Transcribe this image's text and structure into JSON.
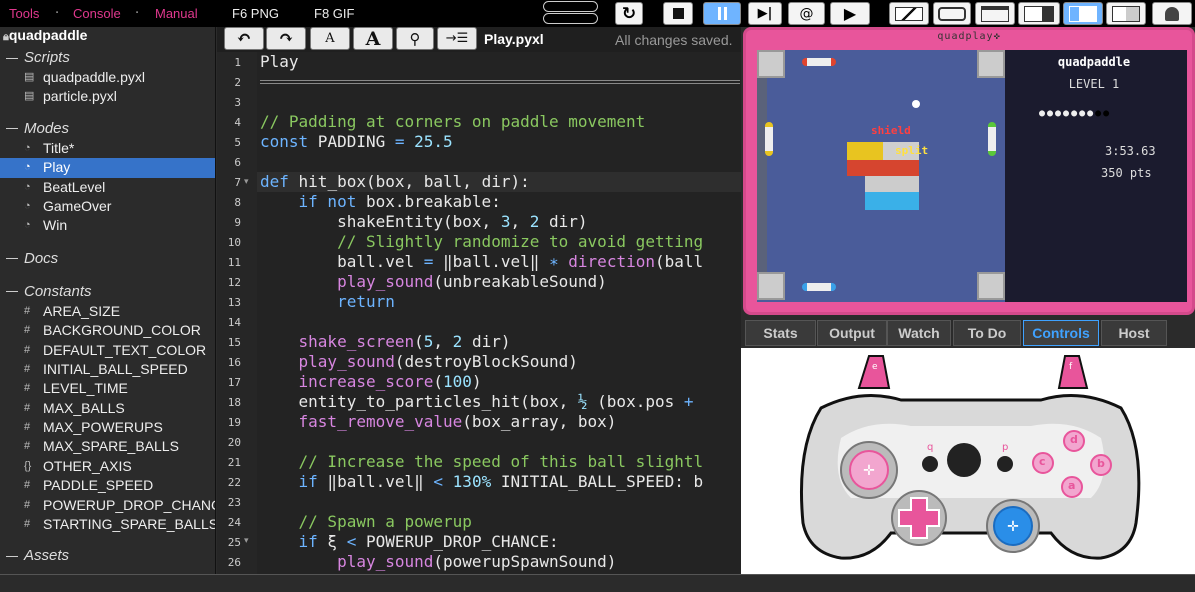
{
  "menu": {
    "tools": "Tools",
    "console": "Console",
    "manual": "Manual",
    "f6": "F6 PNG",
    "f8": "F8 GIF"
  },
  "project": {
    "name": "quadpaddle",
    "sections": {
      "scripts": "Scripts",
      "modes": "Modes",
      "docs": "Docs",
      "constants": "Constants",
      "assets": "Assets"
    },
    "scripts": [
      "quadpaddle.pyxl",
      "particle.pyxl"
    ],
    "modes": [
      "Title*",
      "Play",
      "BeatLevel",
      "GameOver",
      "Win"
    ],
    "constants": [
      "AREA_SIZE",
      "BACKGROUND_COLOR",
      "DEFAULT_TEXT_COLOR",
      "INITIAL_BALL_SPEED",
      "LEVEL_TIME",
      "MAX_BALLS",
      "MAX_POWERUPS",
      "MAX_SPARE_BALLS",
      "OTHER_AXIS",
      "PADDLE_SPEED",
      "POWERUP_DROP_CHANCE",
      "STARTING_SPARE_BALLS"
    ]
  },
  "editor": {
    "filename": "Play.pyxl",
    "status": "All changes saved.",
    "line_numbers": [
      "1",
      "2",
      "3",
      "4",
      "5",
      "6",
      "7",
      "8",
      "9",
      "10",
      "11",
      "12",
      "13",
      "14",
      "15",
      "16",
      "17",
      "18",
      "19",
      "20",
      "21",
      "22",
      "23",
      "24",
      "25",
      "26"
    ]
  },
  "game": {
    "window_title": "quadplay✜",
    "hud_title": "quadpaddle",
    "level": "LEVEL 1",
    "time": "3:53.63",
    "score": "350 pts",
    "float_text_1": "shield",
    "float_text_2": "split"
  },
  "tabs": [
    "Stats",
    "Output",
    "Watch",
    "To Do",
    "Controls",
    "Host"
  ],
  "controller": {
    "btn_e": "e",
    "btn_f": "f",
    "btn_q": "q",
    "btn_p": "p",
    "btn_a": "a",
    "btn_b": "b",
    "btn_c": "c",
    "btn_d": "d"
  },
  "colors": {
    "accent_pink": "#e0388e",
    "selected_blue": "#3673c9",
    "tab_active": "#3fa2ff"
  }
}
